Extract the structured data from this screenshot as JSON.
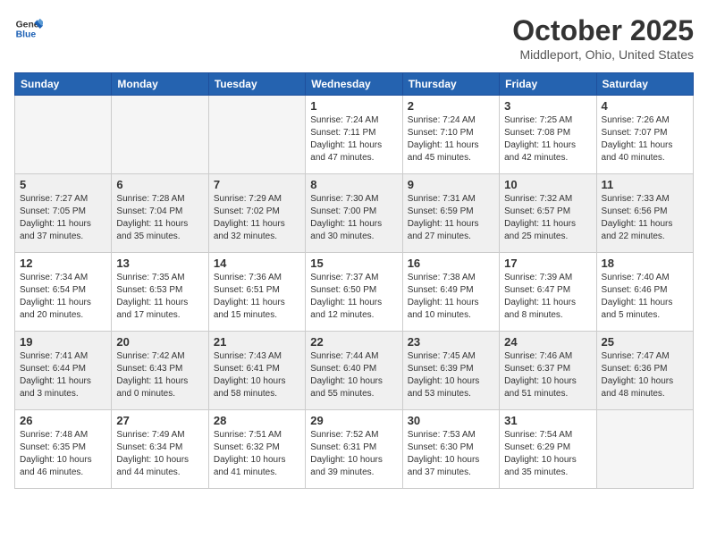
{
  "header": {
    "logo_general": "General",
    "logo_blue": "Blue",
    "month": "October 2025",
    "location": "Middleport, Ohio, United States"
  },
  "weekdays": [
    "Sunday",
    "Monday",
    "Tuesday",
    "Wednesday",
    "Thursday",
    "Friday",
    "Saturday"
  ],
  "weeks": [
    [
      {
        "day": "",
        "info": ""
      },
      {
        "day": "",
        "info": ""
      },
      {
        "day": "",
        "info": ""
      },
      {
        "day": "1",
        "info": "Sunrise: 7:24 AM\nSunset: 7:11 PM\nDaylight: 11 hours\nand 47 minutes."
      },
      {
        "day": "2",
        "info": "Sunrise: 7:24 AM\nSunset: 7:10 PM\nDaylight: 11 hours\nand 45 minutes."
      },
      {
        "day": "3",
        "info": "Sunrise: 7:25 AM\nSunset: 7:08 PM\nDaylight: 11 hours\nand 42 minutes."
      },
      {
        "day": "4",
        "info": "Sunrise: 7:26 AM\nSunset: 7:07 PM\nDaylight: 11 hours\nand 40 minutes."
      }
    ],
    [
      {
        "day": "5",
        "info": "Sunrise: 7:27 AM\nSunset: 7:05 PM\nDaylight: 11 hours\nand 37 minutes."
      },
      {
        "day": "6",
        "info": "Sunrise: 7:28 AM\nSunset: 7:04 PM\nDaylight: 11 hours\nand 35 minutes."
      },
      {
        "day": "7",
        "info": "Sunrise: 7:29 AM\nSunset: 7:02 PM\nDaylight: 11 hours\nand 32 minutes."
      },
      {
        "day": "8",
        "info": "Sunrise: 7:30 AM\nSunset: 7:00 PM\nDaylight: 11 hours\nand 30 minutes."
      },
      {
        "day": "9",
        "info": "Sunrise: 7:31 AM\nSunset: 6:59 PM\nDaylight: 11 hours\nand 27 minutes."
      },
      {
        "day": "10",
        "info": "Sunrise: 7:32 AM\nSunset: 6:57 PM\nDaylight: 11 hours\nand 25 minutes."
      },
      {
        "day": "11",
        "info": "Sunrise: 7:33 AM\nSunset: 6:56 PM\nDaylight: 11 hours\nand 22 minutes."
      }
    ],
    [
      {
        "day": "12",
        "info": "Sunrise: 7:34 AM\nSunset: 6:54 PM\nDaylight: 11 hours\nand 20 minutes."
      },
      {
        "day": "13",
        "info": "Sunrise: 7:35 AM\nSunset: 6:53 PM\nDaylight: 11 hours\nand 17 minutes."
      },
      {
        "day": "14",
        "info": "Sunrise: 7:36 AM\nSunset: 6:51 PM\nDaylight: 11 hours\nand 15 minutes."
      },
      {
        "day": "15",
        "info": "Sunrise: 7:37 AM\nSunset: 6:50 PM\nDaylight: 11 hours\nand 12 minutes."
      },
      {
        "day": "16",
        "info": "Sunrise: 7:38 AM\nSunset: 6:49 PM\nDaylight: 11 hours\nand 10 minutes."
      },
      {
        "day": "17",
        "info": "Sunrise: 7:39 AM\nSunset: 6:47 PM\nDaylight: 11 hours\nand 8 minutes."
      },
      {
        "day": "18",
        "info": "Sunrise: 7:40 AM\nSunset: 6:46 PM\nDaylight: 11 hours\nand 5 minutes."
      }
    ],
    [
      {
        "day": "19",
        "info": "Sunrise: 7:41 AM\nSunset: 6:44 PM\nDaylight: 11 hours\nand 3 minutes."
      },
      {
        "day": "20",
        "info": "Sunrise: 7:42 AM\nSunset: 6:43 PM\nDaylight: 11 hours\nand 0 minutes."
      },
      {
        "day": "21",
        "info": "Sunrise: 7:43 AM\nSunset: 6:41 PM\nDaylight: 10 hours\nand 58 minutes."
      },
      {
        "day": "22",
        "info": "Sunrise: 7:44 AM\nSunset: 6:40 PM\nDaylight: 10 hours\nand 55 minutes."
      },
      {
        "day": "23",
        "info": "Sunrise: 7:45 AM\nSunset: 6:39 PM\nDaylight: 10 hours\nand 53 minutes."
      },
      {
        "day": "24",
        "info": "Sunrise: 7:46 AM\nSunset: 6:37 PM\nDaylight: 10 hours\nand 51 minutes."
      },
      {
        "day": "25",
        "info": "Sunrise: 7:47 AM\nSunset: 6:36 PM\nDaylight: 10 hours\nand 48 minutes."
      }
    ],
    [
      {
        "day": "26",
        "info": "Sunrise: 7:48 AM\nSunset: 6:35 PM\nDaylight: 10 hours\nand 46 minutes."
      },
      {
        "day": "27",
        "info": "Sunrise: 7:49 AM\nSunset: 6:34 PM\nDaylight: 10 hours\nand 44 minutes."
      },
      {
        "day": "28",
        "info": "Sunrise: 7:51 AM\nSunset: 6:32 PM\nDaylight: 10 hours\nand 41 minutes."
      },
      {
        "day": "29",
        "info": "Sunrise: 7:52 AM\nSunset: 6:31 PM\nDaylight: 10 hours\nand 39 minutes."
      },
      {
        "day": "30",
        "info": "Sunrise: 7:53 AM\nSunset: 6:30 PM\nDaylight: 10 hours\nand 37 minutes."
      },
      {
        "day": "31",
        "info": "Sunrise: 7:54 AM\nSunset: 6:29 PM\nDaylight: 10 hours\nand 35 minutes."
      },
      {
        "day": "",
        "info": ""
      }
    ]
  ]
}
